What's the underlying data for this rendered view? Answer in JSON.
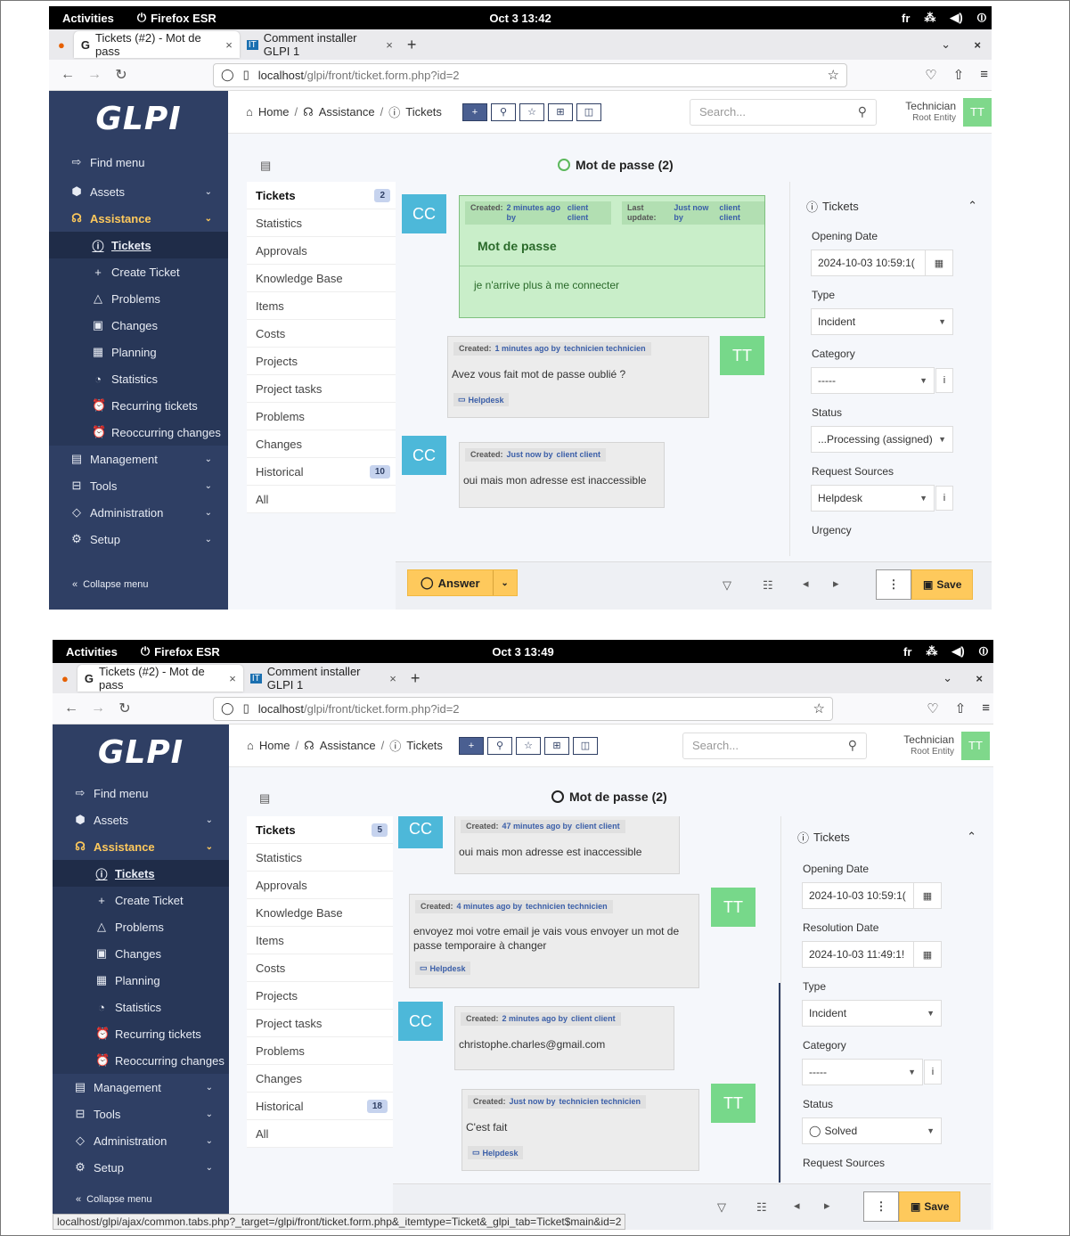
{
  "screens": [
    {
      "topbar": {
        "activities": "Activities",
        "browser": "Firefox ESR",
        "clock": "Oct 3  13:42",
        "lang": "fr"
      },
      "tabs": [
        {
          "label": "Tickets (#2) - Mot de pass",
          "close": "×"
        },
        {
          "label": "Comment installer GLPI 1",
          "close": "×"
        }
      ],
      "url": {
        "host": "localhost",
        "path": "/glpi/front/ticket.form.php?id=2"
      },
      "sidebar": {
        "logo": "GLPI",
        "find": "Find menu",
        "items": [
          "Assets",
          "Assistance",
          "Tickets",
          "Create Ticket",
          "Problems",
          "Changes",
          "Planning",
          "Statistics",
          "Recurring tickets",
          "Reoccurring changes",
          "Management",
          "Tools",
          "Administration",
          "Setup"
        ],
        "collapse": "Collapse menu"
      },
      "breadcrumb": {
        "home": "Home",
        "assistance": "Assistance",
        "tickets": "Tickets"
      },
      "search_placeholder": "Search...",
      "user": {
        "name": "Technician",
        "entity": "Root Entity",
        "initials": "TT"
      },
      "title": "Mot de passe (2)",
      "tabs_list": [
        {
          "label": "Tickets",
          "count": "2"
        },
        {
          "label": "Statistics"
        },
        {
          "label": "Approvals"
        },
        {
          "label": "Knowledge Base"
        },
        {
          "label": "Items"
        },
        {
          "label": "Costs"
        },
        {
          "label": "Projects"
        },
        {
          "label": "Project tasks"
        },
        {
          "label": "Problems"
        },
        {
          "label": "Changes"
        },
        {
          "label": "Historical",
          "count": "10"
        },
        {
          "label": "All"
        }
      ],
      "messages": [
        {
          "created": "Created:",
          "when": "2 minutes ago by",
          "by": "client client",
          "update": "Last update:",
          "update_when": "Just now by",
          "update_by": "client client",
          "title": "Mot de passe",
          "text": "je n'arrive plus à me connecter",
          "avatar": "CC"
        },
        {
          "created": "Created:",
          "when": "1 minutes ago by",
          "by": "technicien technicien",
          "text": "Avez vous fait mot de passe oublié ?",
          "source": "Helpdesk",
          "avatar": "TT"
        },
        {
          "created": "Created:",
          "when": "Just now by",
          "by": "client client",
          "text": "oui mais mon adresse est inaccessible",
          "avatar": "CC"
        }
      ],
      "panel": {
        "header": "Tickets",
        "opening_label": "Opening Date",
        "opening": "2024-10-03 10:59:1(",
        "type_label": "Type",
        "type": "Incident",
        "category_label": "Category",
        "category": "-----",
        "status_label": "Status",
        "status": "...Processing (assigned)",
        "source_label": "Request Sources",
        "source": "Helpdesk",
        "urgency_label": "Urgency"
      },
      "footer": {
        "answer": "Answer",
        "save": "Save"
      }
    },
    {
      "topbar": {
        "activities": "Activities",
        "browser": "Firefox ESR",
        "clock": "Oct 3  13:49",
        "lang": "fr"
      },
      "tabs": [
        {
          "label": "Tickets (#2) - Mot de pass",
          "close": "×"
        },
        {
          "label": "Comment installer GLPI 1",
          "close": "×"
        }
      ],
      "url": {
        "host": "localhost",
        "path": "/glpi/front/ticket.form.php?id=2"
      },
      "title": "Mot de passe (2)",
      "tabs_list": [
        {
          "label": "Tickets",
          "count": "5"
        },
        {
          "label": "Statistics"
        },
        {
          "label": "Approvals"
        },
        {
          "label": "Knowledge Base"
        },
        {
          "label": "Items"
        },
        {
          "label": "Costs"
        },
        {
          "label": "Projects"
        },
        {
          "label": "Project tasks"
        },
        {
          "label": "Problems"
        },
        {
          "label": "Changes"
        },
        {
          "label": "Historical",
          "count": "18"
        },
        {
          "label": "All"
        }
      ],
      "messages": [
        {
          "created": "Created:",
          "when": "47 minutes ago by",
          "by": "client client",
          "text": "oui mais mon adresse est inaccessible",
          "avatar": "CC"
        },
        {
          "created": "Created:",
          "when": "4 minutes ago by",
          "by": "technicien technicien",
          "text": "envoyez moi votre email je vais vous envoyer un mot de passe temporaire à changer",
          "source": "Helpdesk",
          "avatar": "TT"
        },
        {
          "created": "Created:",
          "when": "2 minutes ago by",
          "by": "client client",
          "text": "christophe.charles@gmail.com",
          "avatar": "CC"
        },
        {
          "created": "Created:",
          "when": "Just now by",
          "by": "technicien technicien",
          "text": "C'est fait",
          "source": "Helpdesk",
          "avatar": "TT"
        }
      ],
      "panel": {
        "header": "Tickets",
        "opening_label": "Opening Date",
        "opening": "2024-10-03 10:59:1(",
        "resolution_label": "Resolution Date",
        "resolution": "2024-10-03 11:49:1!",
        "type_label": "Type",
        "type": "Incident",
        "category_label": "Category",
        "category": "-----",
        "status_label": "Status",
        "status": "Solved",
        "source_label": "Request Sources"
      },
      "footer": {
        "save": "Save"
      },
      "statusbar": "localhost/glpi/ajax/common.tabs.php?_target=/glpi/front/ticket.form.php&_itemtype=Ticket&_glpi_tab=Ticket$main&id=2"
    }
  ]
}
